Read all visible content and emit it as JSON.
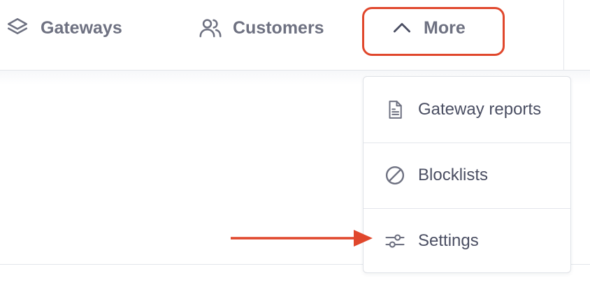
{
  "nav": {
    "items": [
      {
        "label": "Gateways",
        "icon": "layers-icon"
      },
      {
        "label": "Customers",
        "icon": "users-icon"
      },
      {
        "label": "More",
        "icon": "chevron-up-icon"
      }
    ]
  },
  "dropdown": {
    "items": [
      {
        "label": "Gateway reports",
        "icon": "document-icon"
      },
      {
        "label": "Blocklists",
        "icon": "block-icon"
      },
      {
        "label": "Settings",
        "icon": "sliders-icon"
      }
    ]
  },
  "annotation": {
    "highlight_color": "#e0472c",
    "arrow_color": "#e0472c",
    "arrow_target": "Settings"
  },
  "colors": {
    "nav_text": "#6e7181",
    "menu_text": "#4a4e62",
    "border": "#e3e6eb"
  }
}
